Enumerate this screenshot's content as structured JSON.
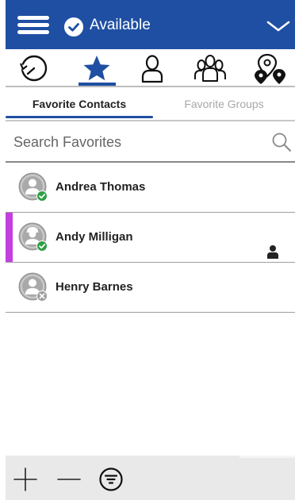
{
  "header": {
    "status_label": "Available",
    "accent_color": "#1f4fa3"
  },
  "icon_tabs": [
    {
      "name": "recents-icon",
      "active": false
    },
    {
      "name": "star-icon",
      "active": true
    },
    {
      "name": "contact-icon",
      "active": false
    },
    {
      "name": "groups-icon",
      "active": false
    },
    {
      "name": "map-pins-icon",
      "active": false
    }
  ],
  "subtabs": {
    "favorite_contacts": "Favorite Contacts",
    "favorite_groups": "Favorite Groups"
  },
  "search": {
    "placeholder": "Search Favorites"
  },
  "contacts": [
    {
      "name": "Andrea Thomas",
      "status": "available",
      "selected": false
    },
    {
      "name": "Andy Milligan",
      "status": "available",
      "selected": true,
      "selection_color": "#c33fe0"
    },
    {
      "name": "Henry Barnes",
      "status": "offline",
      "selected": false
    }
  ],
  "status_colors": {
    "available": "#2e9e44",
    "offline": "#9e9e9e"
  },
  "bottom_bar": [
    "add-icon",
    "remove-icon",
    "filter-icon"
  ]
}
